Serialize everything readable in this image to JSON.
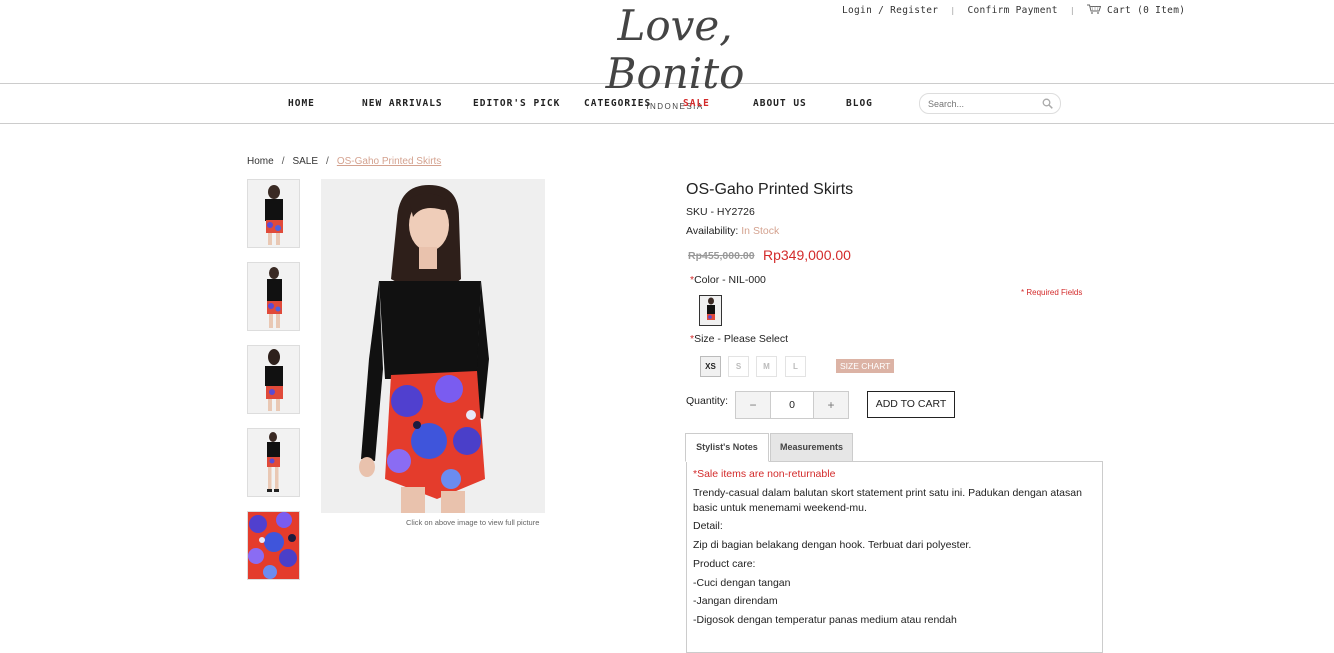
{
  "header": {
    "logo": {
      "script": "Love, Bonito",
      "sub": "INDONESIA"
    },
    "toplinks": {
      "login": "Login / Register",
      "confirm": "Confirm Payment",
      "cart": "Cart (0 Item)",
      "separator": "|"
    }
  },
  "nav": {
    "items": [
      {
        "label": "HOME"
      },
      {
        "label": "NEW ARRIVALS"
      },
      {
        "label": "EDITOR'S PICK"
      },
      {
        "label": "CATEGORIES"
      },
      {
        "label": "SALE"
      },
      {
        "label": "ABOUT US"
      },
      {
        "label": "BLOG"
      }
    ],
    "search_placeholder": "Search..."
  },
  "breadcrumb": {
    "items": [
      "Home",
      "SALE",
      "OS-Gaho Printed Skirts"
    ],
    "separator": "/"
  },
  "gallery": {
    "caption": "Click on above image to view full picture"
  },
  "product": {
    "title": "OS-Gaho Printed Skirts",
    "sku": "SKU - HY2726",
    "availability_label": "Availability:",
    "availability_value": "In Stock",
    "old_price": "Rp455,000.00",
    "new_price": "Rp349,000.00",
    "required_mark": "*",
    "color_label": "Color - NIL-000",
    "required_fields": "* Required Fields",
    "size_label": "Size - Please Select",
    "sizes": [
      "XS",
      "S",
      "M",
      "L"
    ],
    "size_chart": "SIZE CHART",
    "quantity_label": "Quantity:",
    "quantity_minus": "−",
    "quantity_value": "0",
    "quantity_plus": "+",
    "add_to_cart": "ADD TO CART"
  },
  "tabs": {
    "items": [
      {
        "label": "Stylist's Notes"
      },
      {
        "label": "Measurements"
      }
    ],
    "content": {
      "warning": "*Sale items are non-returnable",
      "line1": "Trendy-casual dalam balutan skort statement print satu ini. Padukan dengan atasan",
      "line2": "basic untuk menemami weekend-mu.",
      "detail_label": "Detail:",
      "detail": "Zip di bagian belakang dengan hook. Terbuat dari polyester.",
      "care_label": "Product care:",
      "care1": "-Cuci dengan tangan",
      "care2": "-Jangan direndam",
      "care3": "-Digosok dengan temperatur panas medium atau rendah"
    }
  },
  "colors": {
    "sale_red": "#d32b2b",
    "accent_rose": "#d4a28f",
    "size_chart_bg": "#dcb3a5"
  }
}
